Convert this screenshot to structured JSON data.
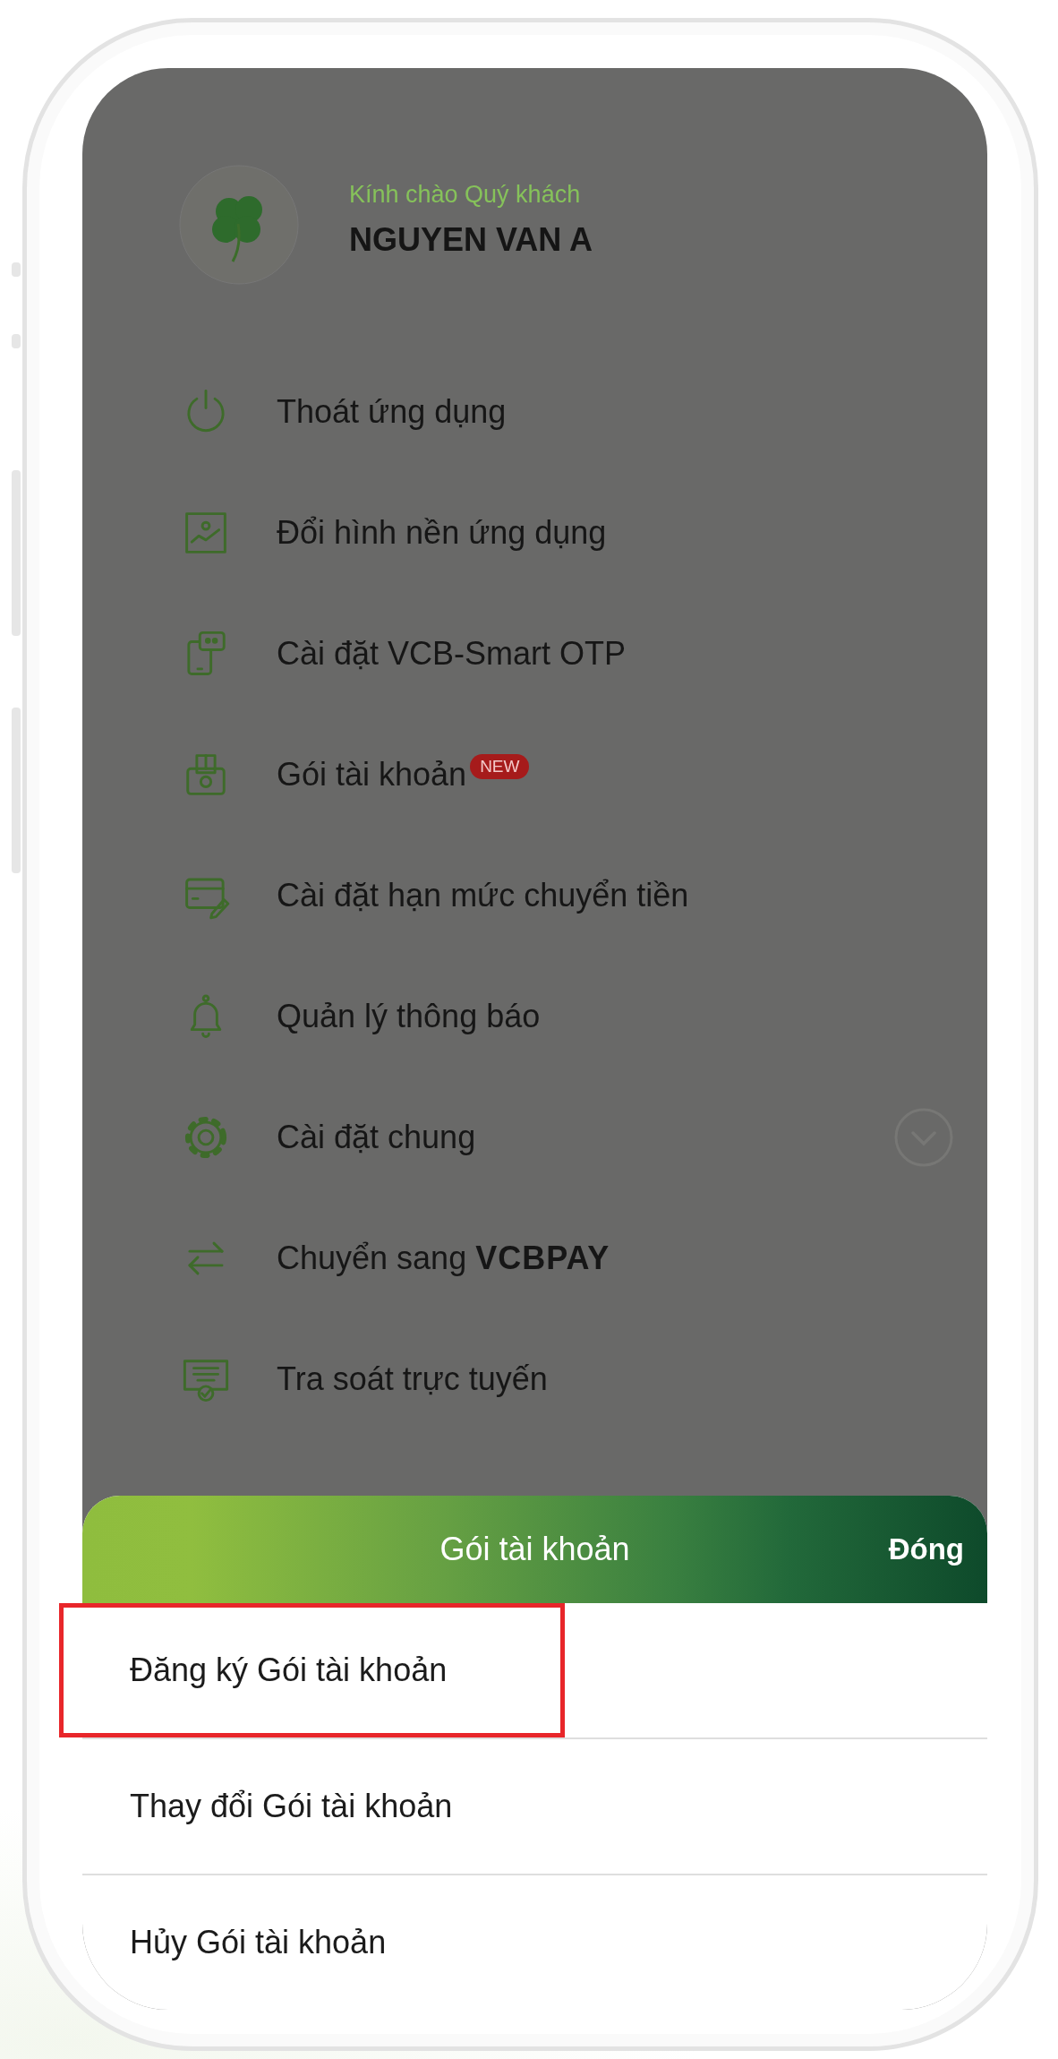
{
  "profile": {
    "greeting": "Kính chào Quý khách",
    "name": "NGUYEN VAN A"
  },
  "menu": [
    {
      "label": "Thoát ứng dụng"
    },
    {
      "label": "Đổi hình nền ứng dụng"
    },
    {
      "label": "Cài đặt VCB-Smart OTP"
    },
    {
      "label": "Gói tài khoản",
      "badge": "NEW"
    },
    {
      "label": "Cài đặt hạn mức chuyển tiền"
    },
    {
      "label": "Quản lý thông báo"
    },
    {
      "label": "Cài đặt chung",
      "toggle": {
        "expanded": false
      }
    },
    {
      "label": "Chuyển sang **VCBPAY**"
    },
    {
      "label": "Tra soát trực tuyến"
    }
  ],
  "sheet": {
    "title": "Gói tài khoản",
    "close_label": "Đóng",
    "options": [
      {
        "label": "Đăng ký Gói tài khoản",
        "highlighted": true
      },
      {
        "label": "Thay đổi Gói tài khoản",
        "highlighted": false
      },
      {
        "label": "Hủy Gói tài khoản",
        "highlighted": false
      }
    ]
  }
}
